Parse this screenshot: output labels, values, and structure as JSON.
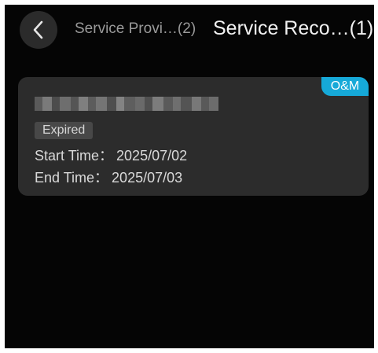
{
  "header": {
    "back_icon": "chevron-left-icon",
    "tabs": [
      {
        "label": "Service Provi…(2)",
        "active": false
      },
      {
        "label": "Service Reco…(1)",
        "active": true
      }
    ]
  },
  "records": [
    {
      "badge": "O&M",
      "status": "Expired",
      "start_label": "Start Time：",
      "start_value": "2025/07/02",
      "end_label": "End Time：",
      "end_value": "2025/07/03"
    }
  ],
  "colors": {
    "background": "#050505",
    "card": "#2c2c2c",
    "badge": "#16a9d8",
    "status_pill": "#484848"
  }
}
